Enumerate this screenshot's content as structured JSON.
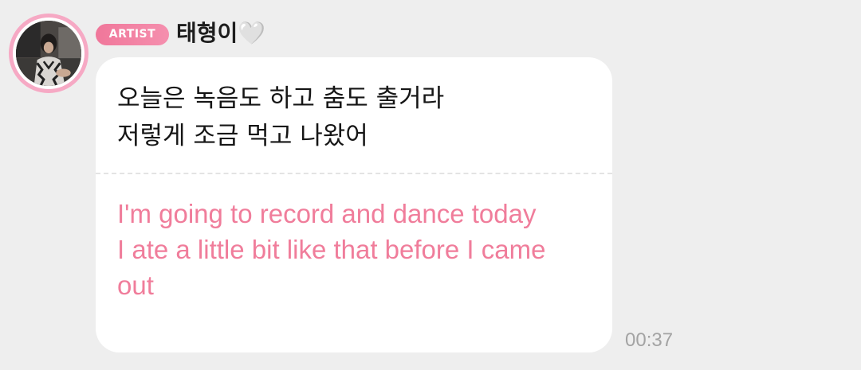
{
  "sender": {
    "badge": "ARTIST",
    "name": "태형이🤍",
    "avatar": "artist-profile-photo"
  },
  "message": {
    "original_lines": [
      "오늘은 녹음도 하고 춤도 출거라",
      "저렇게 조금 먹고 나왔어"
    ],
    "translation_lines": [
      "I'm going to record and dance today",
      "I ate a little bit like that before I came out"
    ],
    "time": "00:37"
  },
  "colors": {
    "background": "#eeeeee",
    "bubble": "#ffffff",
    "badge": "#f0779a",
    "avatar_ring": "#f6a9c4",
    "translation_text": "#f07d9b",
    "timestamp": "#a3a3a3"
  }
}
